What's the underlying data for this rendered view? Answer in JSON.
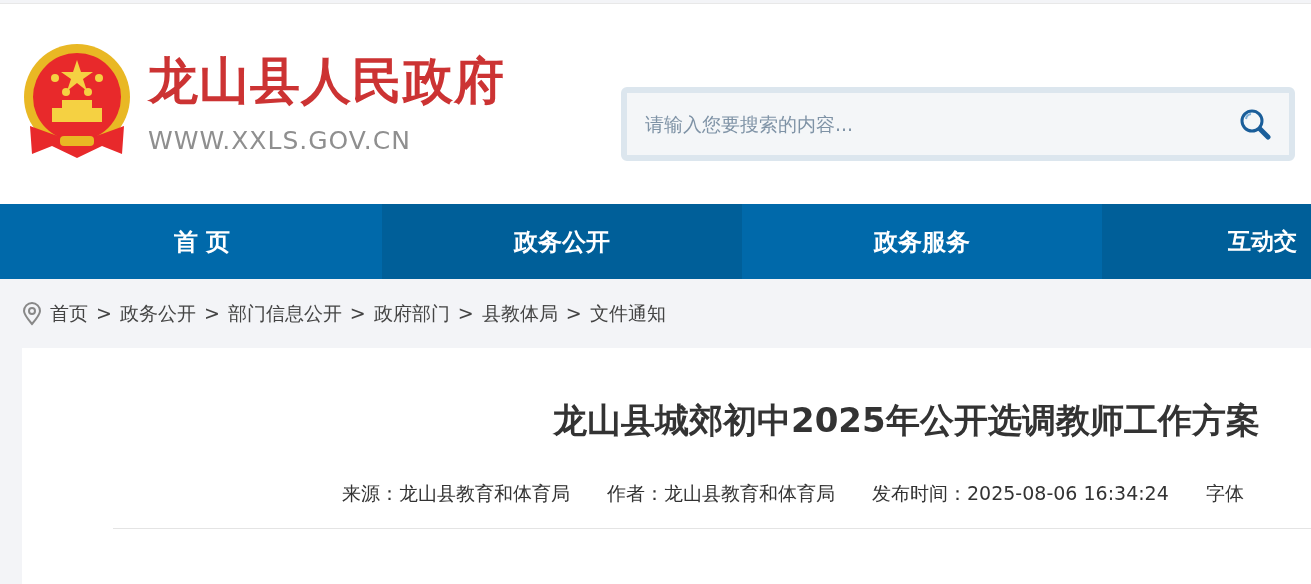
{
  "site": {
    "name": "龙山县人民政府",
    "url": "WWW.XXLS.GOV.CN"
  },
  "search": {
    "placeholder": "请输入您要搜索的内容..."
  },
  "nav": [
    {
      "label": "首 页"
    },
    {
      "label": "政务公开"
    },
    {
      "label": "政务服务"
    },
    {
      "label": "互动交"
    }
  ],
  "breadcrumb": [
    "首页",
    "政务公开",
    "部门信息公开",
    "政府部门",
    "县教体局",
    "文件通知"
  ],
  "breadcrumb_separator": ">",
  "article": {
    "title": "龙山县城郊初中2025年公开选调教师工作方案",
    "meta": [
      "来源：龙山县教育和体育局",
      "作者：龙山县教育和体育局",
      "发布时间：2025-08-06 16:34:24",
      "字体"
    ]
  }
}
